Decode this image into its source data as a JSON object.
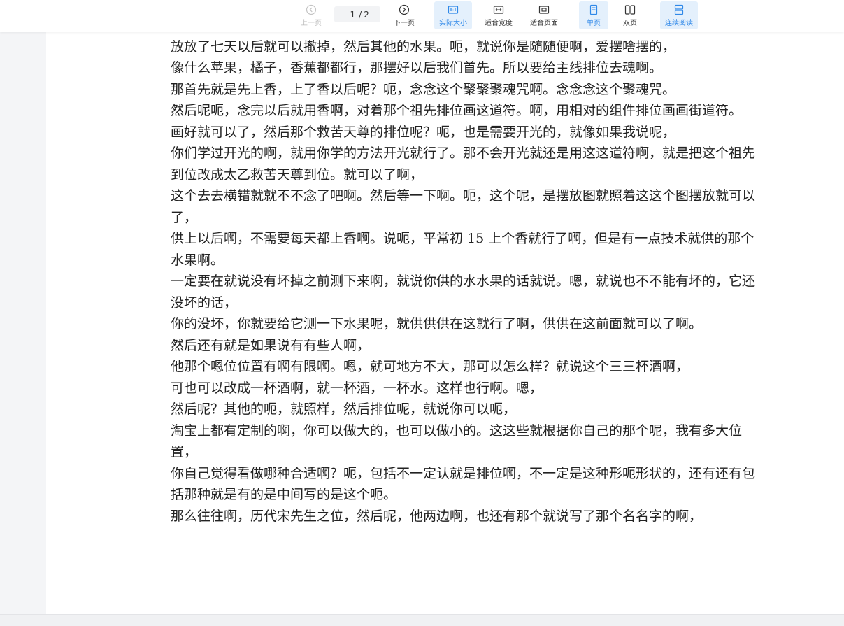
{
  "toolbar": {
    "prev_label": "上一页",
    "page_current": "1",
    "page_separator": "/",
    "page_total": "2",
    "next_label": "下一页",
    "actual_size_label": "实际大小",
    "fit_width_label": "适合宽度",
    "fit_page_label": "适合页面",
    "single_page_label": "单页",
    "double_page_label": "双页",
    "continuous_label": "连续阅读",
    "accent_color": "#2f88e8"
  },
  "document": {
    "top_cut_line": "七天,",
    "paragraphs": [
      "放放了七天以后就可以撤掉，然后其他的水果。呃，就说你是随随便啊，爱摆啥摆的，",
      "像什么苹果，橘子，香蕉都都行，那摆好以后我们首先。所以要给主线排位去魂啊。",
      "那首先就是先上香，上了香以后呢？呃，念念这个聚聚聚魂咒啊。念念念这个聚魂咒。",
      "然后呢呃，念完以后就用香啊，对着那个祖先排位画这道符。啊，用相对的组件排位画画街道符。",
      "画好就可以了，然后那个救苦天尊的排位呢？呃，也是需要开光的，就像如果我说呢，",
      "你们学过开光的啊，就用你学的方法开光就行了。那不会开光就还是用这这道符啊，就是把这个祖先到位改成太乙救苦天尊到位。就可以了啊，",
      "这个去去横错就就不不念了吧啊。然后等一下啊。呃，这个呢，是摆放图就照着这这个图摆放就可以了，",
      "供上以后啊，不需要每天都上香啊。说呃，平常初 15 上个香就行了啊，但是有一点技术就供的那个水果啊。",
      "一定要在就说没有坏掉之前测下来啊，就说你供的水水果的话就说。嗯，就说也不不能有坏的，它还没坏的话，",
      "你的没坏，你就要给它测一下水果呢，就供供供在这就行了啊，供供在这前面就可以了啊。",
      "然后还有就是如果说有有些人啊，",
      "他那个嗯位位置有啊有限啊。嗯，就可地方不大，那可以怎么样？就说这个三三杯酒啊，",
      "可也可以改成一杯酒啊，就一杯酒，一杯水。这样也行啊。嗯，",
      "然后呢？其他的呃，就照样，然后排位呢，就说你可以呃，",
      "淘宝上都有定制的啊，你可以做大的，也可以做小的。这这些就根据你自己的那个呢，我有多大位置，",
      "你自己觉得看做哪种合适啊？呃，包括不一定认就是排位啊，不一定是这种形呃形状的，还有还有包括那种就是有的是中间写的是这个呃。",
      "那么往往啊，历代宋先生之位，然后呢，他两边啊，也还有那个就说写了那个名名字的啊，"
    ]
  }
}
